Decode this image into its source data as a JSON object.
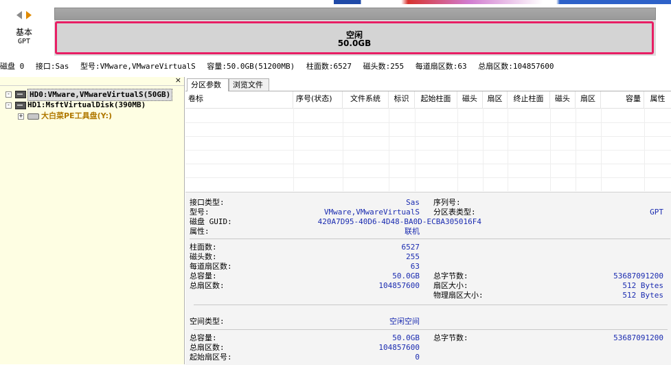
{
  "nav": {
    "back_icon": "arrow-left-icon",
    "forward_icon": "arrow-right-icon"
  },
  "disk_map": {
    "type": "基本",
    "style": "GPT",
    "free_label": "空闲",
    "free_size": "50.0GB",
    "free_border_color": "#e81e64"
  },
  "disk_info": {
    "disk": "磁盘 0",
    "interface": "接口:Sas",
    "model": "型号:VMware,VMwareVirtualS",
    "capacity": "容量:50.0GB(51200MB)",
    "cylinders": "柱面数:6527",
    "heads": "磁头数:255",
    "sectors_per_track": "每道扇区数:63",
    "total_sectors": "总扇区数:104857600"
  },
  "tree": {
    "close": "×",
    "items": [
      {
        "label": "HD0:VMware,VMwareVirtualS(50GB)",
        "expand": "-"
      },
      {
        "label": "HD1:MsftVirtualDisk(390MB)",
        "expand": "-"
      },
      {
        "label": "大白菜PE工具盘(Y:)",
        "expand": "+"
      }
    ]
  },
  "tabs": [
    {
      "label": "分区参数"
    },
    {
      "label": "浏览文件"
    }
  ],
  "table": {
    "columns": [
      "卷标",
      "序号(状态)",
      "文件系统",
      "标识",
      "起始柱面",
      "磁头",
      "扇区",
      "终止柱面",
      "磁头",
      "扇区",
      "容量",
      "属性"
    ],
    "rows": []
  },
  "details": {
    "interface_type_label": "接口类型:",
    "interface_type_value": "Sas",
    "serial_label": "序列号:",
    "serial_value": "",
    "model_label": "型号:",
    "model_value": "VMware,VMwareVirtualS",
    "pt_type_label": "分区表类型:",
    "pt_type_value": "GPT",
    "guid_label": "磁盘 GUID:",
    "guid_value": "420A7D95-40D6-4D48-BA0D-ECBA305016F4",
    "attr_label": "属性:",
    "attr_value": "联机",
    "cyl_label": "柱面数:",
    "cyl_value": "6527",
    "heads_label": "磁头数:",
    "heads_value": "255",
    "spt_label": "每道扇区数:",
    "spt_value": "63",
    "cap_label": "总容量:",
    "cap_value": "50.0GB",
    "bytes_label": "总字节数:",
    "bytes_value": "53687091200",
    "sectors_label": "总扇区数:",
    "sectors_value": "104857600",
    "sector_size_label": "扇区大小:",
    "sector_size_value": "512 Bytes",
    "phys_sector_label": "物理扇区大小:",
    "phys_sector_value": "512 Bytes",
    "space_type_label": "空间类型:",
    "space_type_value": "空闲空间",
    "free_cap_label": "总容量:",
    "free_cap_value": "50.0GB",
    "free_bytes_label": "总字节数:",
    "free_bytes_value": "53687091200",
    "free_sectors_label": "总扇区数:",
    "free_sectors_value": "104857600",
    "start_sector_label": "起始扇区号:",
    "start_sector_value": "0"
  }
}
